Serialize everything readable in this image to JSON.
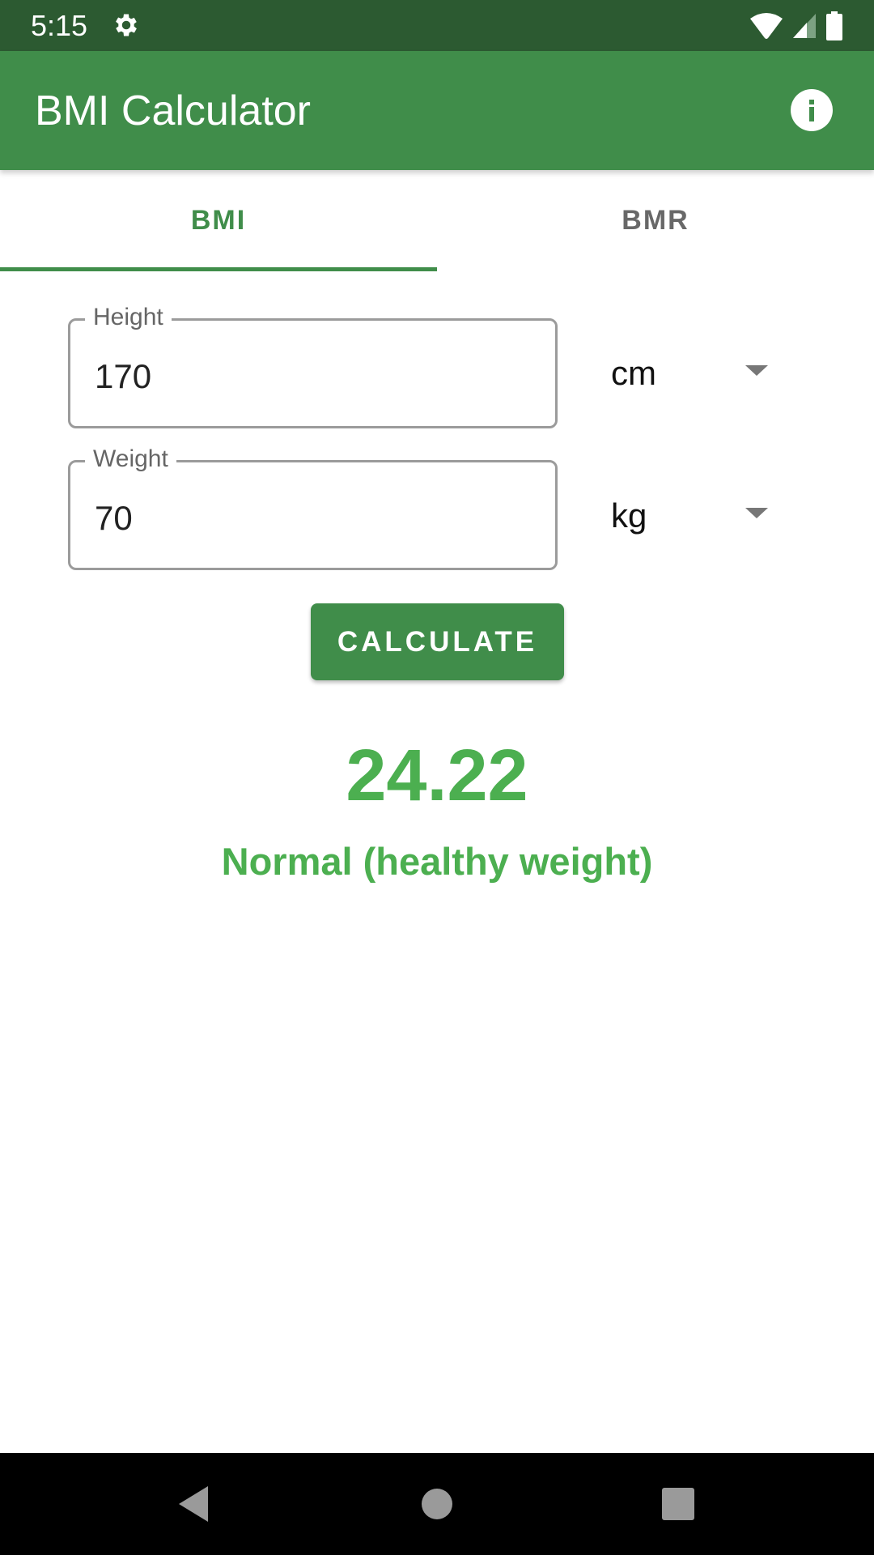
{
  "status_bar": {
    "time": "5:15",
    "icons": [
      "settings-gear-icon",
      "wifi-icon",
      "cell-signal-icon",
      "battery-icon"
    ]
  },
  "app_bar": {
    "title": "BMI Calculator",
    "action_icon": "info-icon",
    "color": "#408d4a"
  },
  "tabs": [
    {
      "label": "BMI",
      "selected": true
    },
    {
      "label": "BMR",
      "selected": false
    }
  ],
  "form": {
    "height": {
      "label": "Height",
      "value": "170",
      "unit": "cm"
    },
    "weight": {
      "label": "Weight",
      "value": "70",
      "unit": "kg"
    },
    "calculate_label": "CALCULATE"
  },
  "result": {
    "bmi_value": "24.22",
    "category": "Normal (healthy weight)",
    "color": "#4caf50"
  },
  "nav_bar": {
    "buttons": [
      "back-icon",
      "home-icon",
      "recents-icon"
    ]
  }
}
